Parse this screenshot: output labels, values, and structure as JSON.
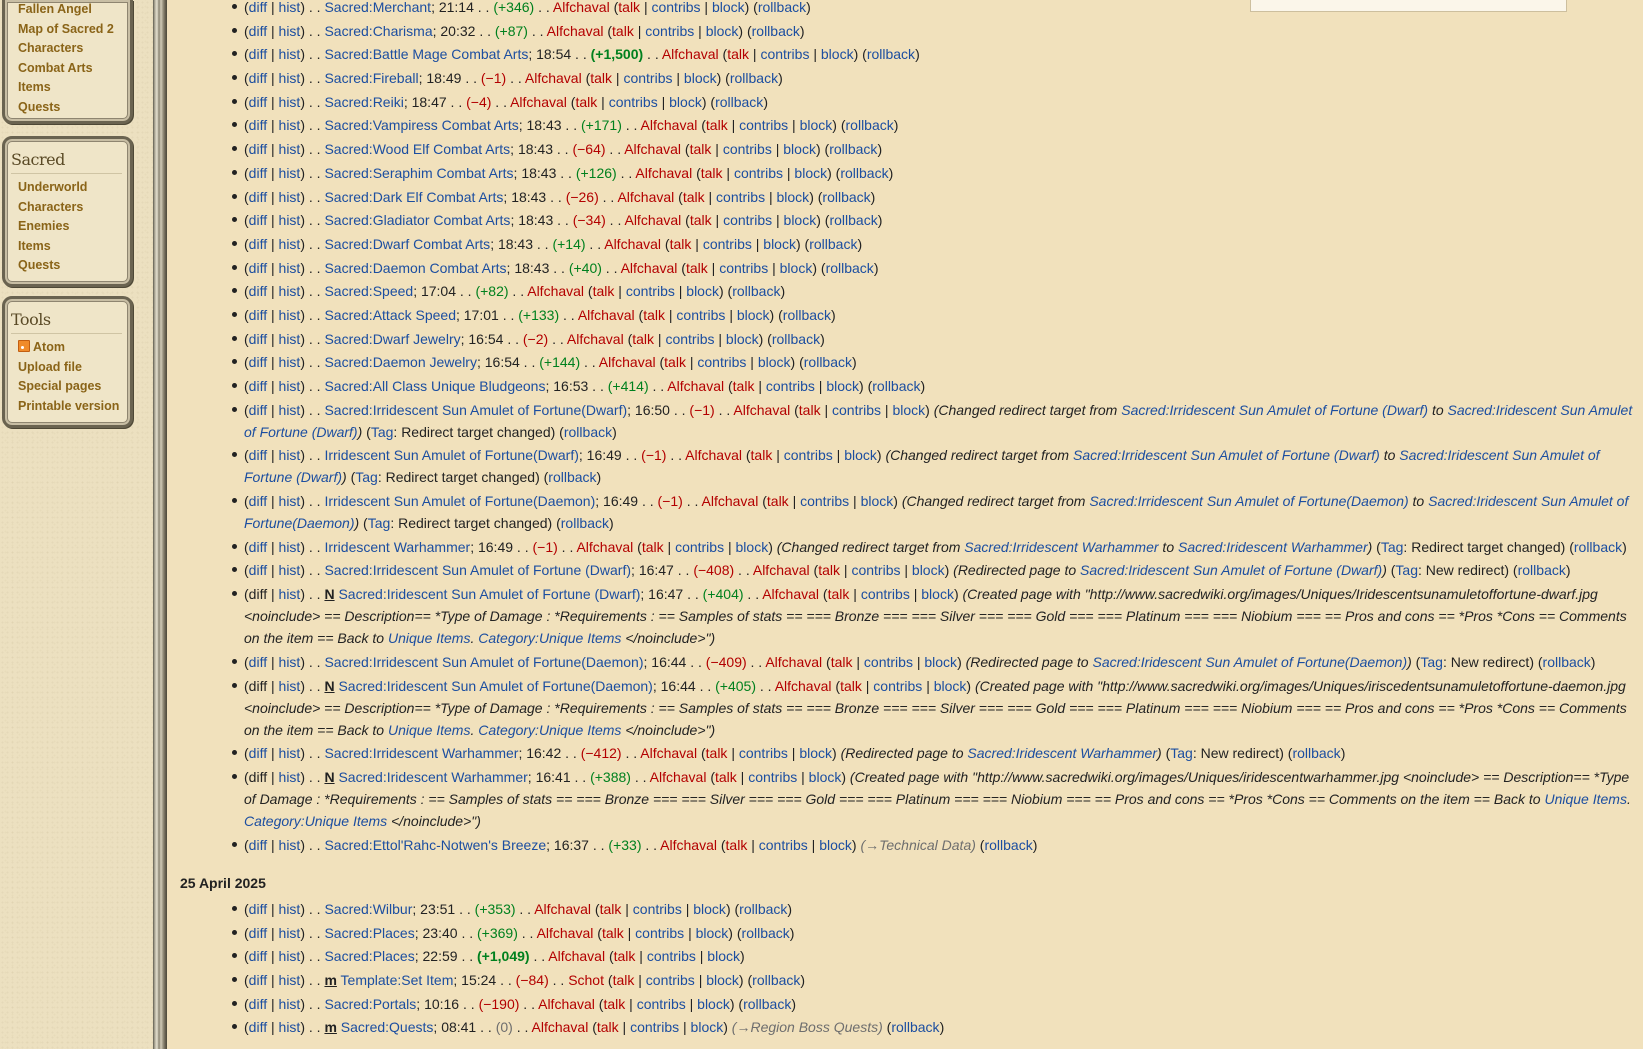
{
  "sidebar": {
    "top_items": [
      "Fallen Angel",
      "Map of Sacred 2",
      "Characters",
      "Combat Arts",
      "Items",
      "Quests"
    ],
    "sacred": {
      "title": "Sacred",
      "items": [
        "Underworld",
        "Characters",
        "Enemies",
        "Items",
        "Quests"
      ]
    },
    "tools": {
      "title": "Tools",
      "items": [
        "Atom",
        "Upload file",
        "Special pages",
        "Printable version"
      ]
    }
  },
  "links": {
    "diff": "diff",
    "hist": "hist",
    "talk": "talk",
    "contribs": "contribs",
    "block": "block",
    "rollback": "rollback",
    "tag": "Tag"
  },
  "changes_a": [
    {
      "page": "Sacred:Merchant",
      "time": "21:14",
      "size": "(+346)",
      "user": "Alfchaval"
    },
    {
      "page": "Sacred:Charisma",
      "time": "20:32",
      "size": "(+87)",
      "user": "Alfchaval"
    },
    {
      "page": "Sacred:Battle Mage Combat Arts",
      "time": "18:54",
      "size": "(+1,500)",
      "user": "Alfchaval",
      "big": true
    },
    {
      "page": "Sacred:Fireball",
      "time": "18:49",
      "size": "(−1)",
      "user": "Alfchaval"
    },
    {
      "page": "Sacred:Reiki",
      "time": "18:47",
      "size": "(−4)",
      "user": "Alfchaval"
    },
    {
      "page": "Sacred:Vampiress Combat Arts",
      "time": "18:43",
      "size": "(+171)",
      "user": "Alfchaval"
    },
    {
      "page": "Sacred:Wood Elf Combat Arts",
      "time": "18:43",
      "size": "(−64)",
      "user": "Alfchaval"
    },
    {
      "page": "Sacred:Seraphim Combat Arts",
      "time": "18:43",
      "size": "(+126)",
      "user": "Alfchaval"
    },
    {
      "page": "Sacred:Dark Elf Combat Arts",
      "time": "18:43",
      "size": "(−26)",
      "user": "Alfchaval"
    },
    {
      "page": "Sacred:Gladiator Combat Arts",
      "time": "18:43",
      "size": "(−34)",
      "user": "Alfchaval"
    },
    {
      "page": "Sacred:Dwarf Combat Arts",
      "time": "18:43",
      "size": "(+14)",
      "user": "Alfchaval"
    },
    {
      "page": "Sacred:Daemon Combat Arts",
      "time": "18:43",
      "size": "(+40)",
      "user": "Alfchaval"
    },
    {
      "page": "Sacred:Speed",
      "time": "17:04",
      "size": "(+82)",
      "user": "Alfchaval"
    },
    {
      "page": "Sacred:Attack Speed",
      "time": "17:01",
      "size": "(+133)",
      "user": "Alfchaval"
    },
    {
      "page": "Sacred:Dwarf Jewelry",
      "time": "16:54",
      "size": "(−2)",
      "user": "Alfchaval"
    },
    {
      "page": "Sacred:Daemon Jewelry",
      "time": "16:54",
      "size": "(+144)",
      "user": "Alfchaval"
    },
    {
      "page": "Sacred:All Class Unique Bludgeons",
      "time": "16:53",
      "size": "(+414)",
      "user": "Alfchaval"
    }
  ],
  "changes_b": [
    {
      "page": "Sacred:Irridescent Sun Amulet of Fortune(Dwarf)",
      "time": "16:50",
      "size": "(−1)",
      "user": "Alfchaval",
      "summary": {
        "pre": "(Changed redirect target from ",
        "l1": "Sacred:Irridescent Sun Amulet of Fortune (Dwarf)",
        "mid": " to ",
        "l2": "Sacred:Iridescent Sun Amulet of Fortune (Dwarf)",
        "post": ")"
      },
      "tag_value": "Redirect target changed"
    },
    {
      "page": "Irridescent Sun Amulet of Fortune(Dwarf)",
      "time": "16:49",
      "size": "(−1)",
      "user": "Alfchaval",
      "summary": {
        "pre": "(Changed redirect target from ",
        "l1": "Sacred:Irridescent Sun Amulet of Fortune (Dwarf)",
        "mid": " to ",
        "l2": "Sacred:Iridescent Sun Amulet of Fortune (Dwarf)",
        "post": ")"
      },
      "tag_value": "Redirect target changed"
    },
    {
      "page": "Irridescent Sun Amulet of Fortune(Daemon)",
      "time": "16:49",
      "size": "(−1)",
      "user": "Alfchaval",
      "summary": {
        "pre": "(Changed redirect target from ",
        "l1": "Sacred:Irridescent Sun Amulet of Fortune(Daemon)",
        "mid": " to ",
        "l2": "Sacred:Iridescent Sun Amulet of Fortune(Daemon)",
        "post": ")"
      },
      "tag_value": "Redirect target changed"
    },
    {
      "page": "Irridescent Warhammer",
      "time": "16:49",
      "size": "(−1)",
      "user": "Alfchaval",
      "summary": {
        "pre": "(Changed redirect target from ",
        "l1": "Sacred:Irridescent Warhammer",
        "mid": " to ",
        "l2": "Sacred:Iridescent Warhammer",
        "post": ")"
      },
      "tag_value": "Redirect target changed"
    },
    {
      "page": "Sacred:Irridescent Sun Amulet of Fortune (Dwarf)",
      "time": "16:47",
      "size": "(−408)",
      "user": "Alfchaval",
      "summary": {
        "pre": "(Redirected page to ",
        "l1": "Sacred:Iridescent Sun Amulet of Fortune (Dwarf)",
        "mid": "",
        "l2": "",
        "post": ")"
      },
      "tag_value": "New redirect"
    }
  ],
  "created": [
    {
      "flag": "N",
      "page": "Sacred:Iridescent Sun Amulet of Fortune (Dwarf)",
      "time": "16:47",
      "size": "(+404)",
      "user": "Alfchaval",
      "text": "(Created page with \"http://www.sacredwiki.org/images/Uniques/Iridescentsunamuletoffortune-dwarf.jpg <noinclude> == Description== *Type of Damage : *Requirements : == Samples of stats == === Bronze === === Silver === === Gold === === Platinum === === Niobium === == Pros and cons == *Pros *Cons == Comments on the item == Back to ",
      "l1": "Unique Items",
      "dot": ". ",
      "l2": "Category:Unique Items",
      "end": " </noinclude>\")"
    },
    {
      "redirect": true,
      "page": "Sacred:Irridescent Sun Amulet of Fortune(Daemon)",
      "time": "16:44",
      "size": "(−409)",
      "user": "Alfchaval",
      "summary_pre": "(Redirected page to ",
      "summary_link": "Sacred:Iridescent Sun Amulet of Fortune(Daemon)",
      "summary_post": ")",
      "tag_value": "New redirect"
    },
    {
      "flag": "N",
      "page": "Sacred:Iridescent Sun Amulet of Fortune(Daemon)",
      "time": "16:44",
      "size": "(+405)",
      "user": "Alfchaval",
      "text": "(Created page with \"http://www.sacredwiki.org/images/Uniques/iriscedentsunamuletoffortune-daemon.jpg <noinclude> == Description== *Type of Damage : *Requirements : == Samples of stats == === Bronze === === Silver === === Gold === === Platinum === === Niobium === == Pros and cons == *Pros *Cons == Comments on the item == Back to ",
      "l1": "Unique Items",
      "dot": ". ",
      "l2": "Category:Unique Items",
      "end": " </noinclude>\")"
    },
    {
      "redirect": true,
      "page": "Sacred:Irridescent Warhammer",
      "time": "16:42",
      "size": "(−412)",
      "user": "Alfchaval",
      "summary_pre": "(Redirected page to ",
      "summary_link": "Sacred:Iridescent Warhammer",
      "summary_post": ")",
      "tag_value": "New redirect"
    },
    {
      "flag": "N",
      "page": "Sacred:Iridescent Warhammer",
      "time": "16:41",
      "size": "(+388)",
      "user": "Alfchaval",
      "text": "(Created page with \"http://www.sacredwiki.org/images/Uniques/iridescentwarhammer.jpg <noinclude> == Description== *Type of Damage : *Requirements : == Samples of stats == === Bronze === === Silver === === Gold === === Platinum === === Niobium === == Pros and cons == *Pros *Cons == Comments on the item == Back to ",
      "l1": "Unique Items",
      "dot": ". ",
      "l2": "Category:Unique Items",
      "end": " </noinclude>\")"
    },
    {
      "page": "Sacred:Ettol'Rahc-Notwen's Breeze",
      "time": "16:37",
      "size": "(+33)",
      "user": "Alfchaval",
      "summary": "(→Technical Data)"
    }
  ],
  "date_header": "25 April 2025",
  "changes_c": [
    {
      "page": "Sacred:Wilbur",
      "time": "23:51",
      "size": "(+353)",
      "user": "Alfchaval",
      "rollback": true
    },
    {
      "page": "Sacred:Places",
      "time": "23:40",
      "size": "(+369)",
      "user": "Alfchaval",
      "rollback": true
    },
    {
      "page": "Sacred:Places",
      "time": "22:59",
      "size": "(+1,049)",
      "user": "Alfchaval",
      "big": true,
      "rollback": false
    },
    {
      "flag": "m",
      "page": "Template:Set Item",
      "time": "15:24",
      "size": "(−84)",
      "user": "Schot",
      "rollback": true
    },
    {
      "page": "Sacred:Portals",
      "time": "10:16",
      "size": "(−190)",
      "user": "Alfchaval",
      "rollback": true
    },
    {
      "flag": "m",
      "page": "Sacred:Quests",
      "time": "08:41",
      "size": "(0)",
      "user": "Alfchaval",
      "summary": "(→Region Boss Quests)",
      "rollback": true
    }
  ]
}
